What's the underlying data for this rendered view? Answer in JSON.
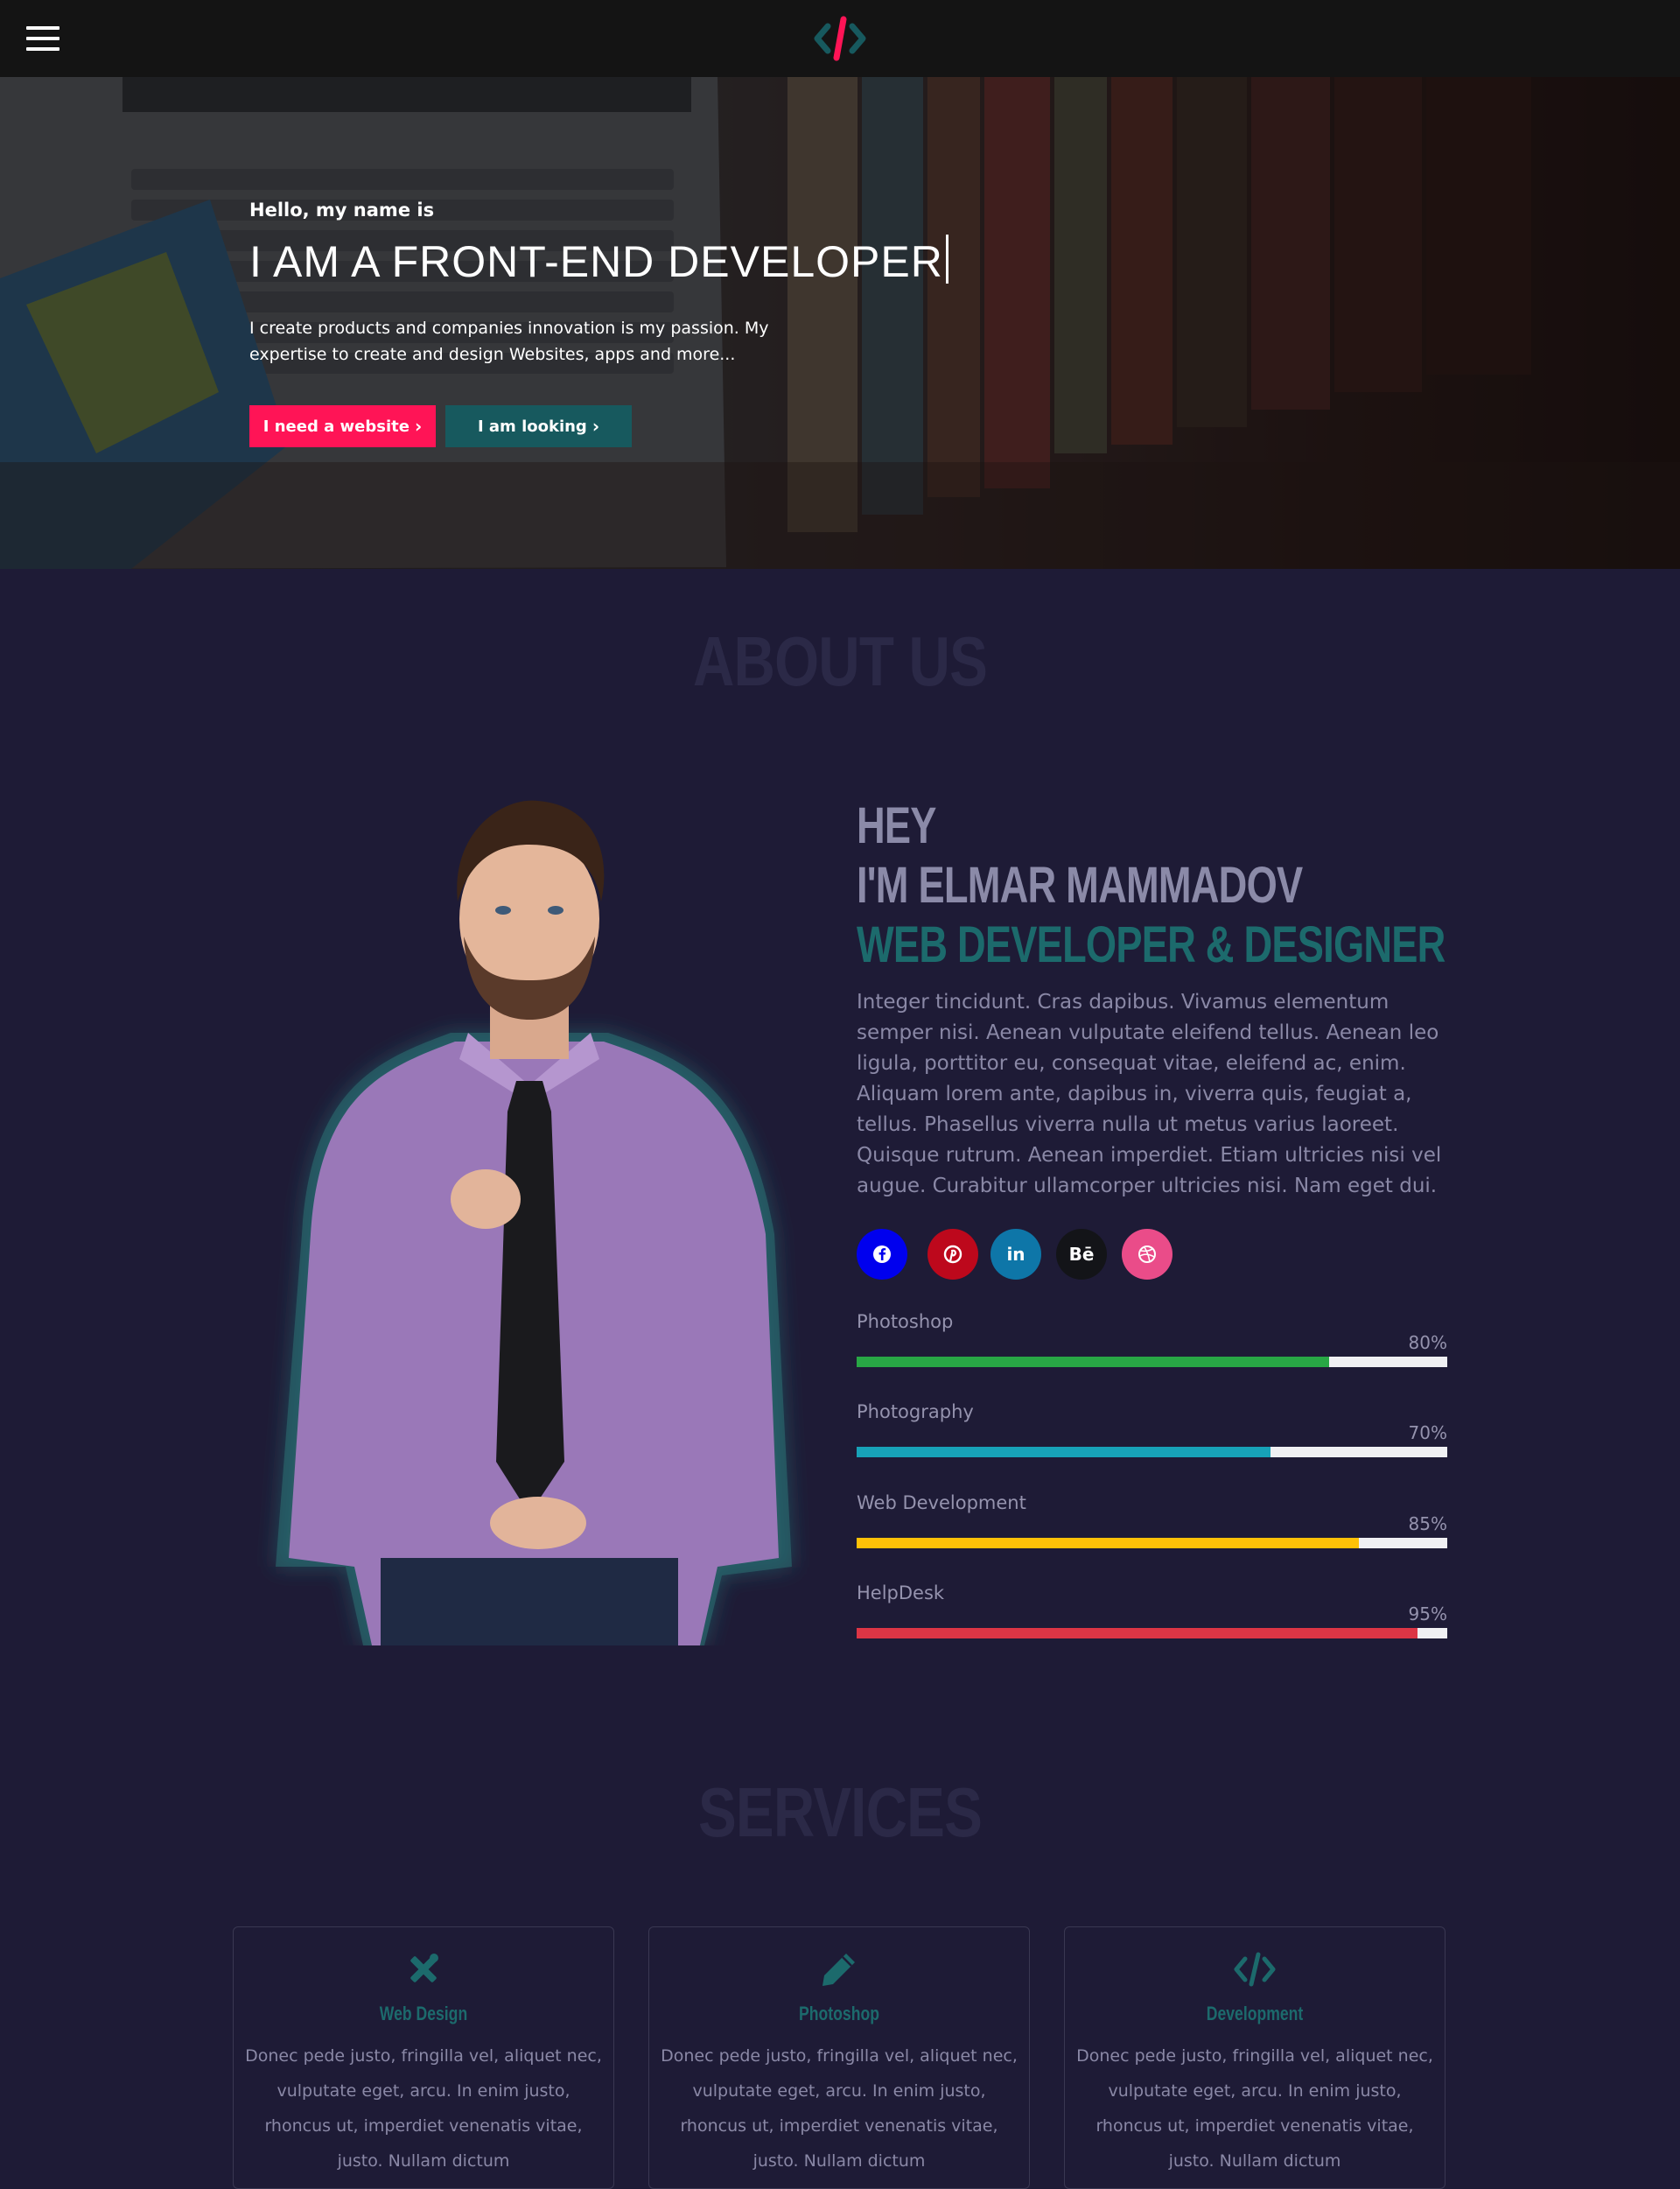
{
  "colors": {
    "accent_pink": "#ff1456",
    "accent_teal": "#17595e",
    "heading_teal": "#1c6a6c",
    "page_background": "#1e1b36",
    "navbar_background": "#141414"
  },
  "navbar": {
    "menu_icon": "hamburger-icon",
    "logo_icon": "code-brackets-icon"
  },
  "hero": {
    "greeting": "Hello, my name is",
    "title": "I AM A FRONT-END DEVELOPER",
    "description": "I create products and companies innovation is my passion. My expertise to create and design Websites, apps and more...",
    "primary_button": "I need a website",
    "secondary_button": "I am looking"
  },
  "about": {
    "section_title": "ABOUT US",
    "line1": "HEY",
    "line2": "I'M ELMAR MAMMADOV",
    "line3": "WEB DEVELOPER & DESIGNER",
    "paragraph": "Integer tincidunt. Cras dapibus. Vivamus elementum semper nisi. Aenean vulputate eleifend tellus. Aenean leo ligula, porttitor eu, consequat vitae, eleifend ac, enim. Aliquam lorem ante, dapibus in, viverra quis, feugiat a, tellus. Phasellus viverra nulla ut metus varius laoreet. Quisque rutrum. Aenean imperdiet. Etiam ultricies nisi vel augue. Curabitur ullamcorper ultricies nisi. Nam eget dui.",
    "socials": [
      {
        "icon": "facebook-icon",
        "color": "#0000ee"
      },
      {
        "icon": "pinterest-icon",
        "color": "#bd081c"
      },
      {
        "icon": "linkedin-icon",
        "label": "in",
        "color": "#0e76a8"
      },
      {
        "icon": "behance-icon",
        "label": "Bē",
        "color": "#131418"
      },
      {
        "icon": "dribbble-icon",
        "color": "#ea4c89"
      }
    ],
    "skills": [
      {
        "label": "Photoshop",
        "percent": "80%",
        "value": 80,
        "color": "#28a745"
      },
      {
        "label": "Photography",
        "percent": "70%",
        "value": 70,
        "color": "#17a2b8"
      },
      {
        "label": "Web Development",
        "percent": "85%",
        "value": 85,
        "color": "#ffc107"
      },
      {
        "label": "HelpDesk",
        "percent": "95%",
        "value": 95,
        "color": "#dc3545"
      }
    ]
  },
  "services": {
    "section_title": "SERVICES",
    "cards": [
      {
        "icon": "design-tools-icon",
        "title": "Web Design",
        "text": "Donec pede justo, fringilla vel, aliquet nec, vulputate eget, arcu. In enim justo, rhoncus ut, imperdiet venenatis vitae, justo. Nullam dictum"
      },
      {
        "icon": "pencil-icon",
        "title": "Photoshop",
        "text": "Donec pede justo, fringilla vel, aliquet nec, vulputate eget, arcu. In enim justo, rhoncus ut, imperdiet venenatis vitae, justo. Nullam dictum"
      },
      {
        "icon": "code-icon",
        "title": "Development",
        "text": "Donec pede justo, fringilla vel, aliquet nec, vulputate eget, arcu. In enim justo, rhoncus ut, imperdiet venenatis vitae, justo. Nullam dictum"
      }
    ]
  }
}
